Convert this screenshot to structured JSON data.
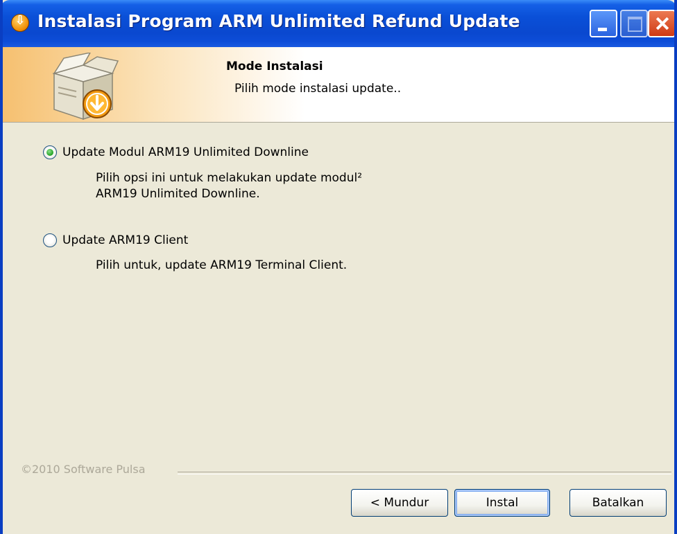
{
  "window": {
    "title": "Instalasi Program ARM Unlimited Refund Update"
  },
  "header": {
    "title": "Mode Instalasi",
    "subtitle": "Pilih mode instalasi update.."
  },
  "options": [
    {
      "label": "Update Modul ARM19 Unlimited Downline",
      "selected": true,
      "description_lines": [
        "Pilih opsi ini untuk melakukan update modul²",
        "ARM19 Unlimited Downline."
      ]
    },
    {
      "label": "Update ARM19 Client",
      "selected": false,
      "description_lines": [
        "Pilih untuk, update ARM19 Terminal Client."
      ]
    }
  ],
  "footer": {
    "branding": "©2010 Software Pulsa"
  },
  "buttons": {
    "back": "< Mundur",
    "install": "Instal",
    "cancel": "Batalkan"
  },
  "colors": {
    "titlebar": "#0a50d8",
    "dialog_bg": "#ece9d8",
    "header_gradient_start": "#f6c070"
  }
}
